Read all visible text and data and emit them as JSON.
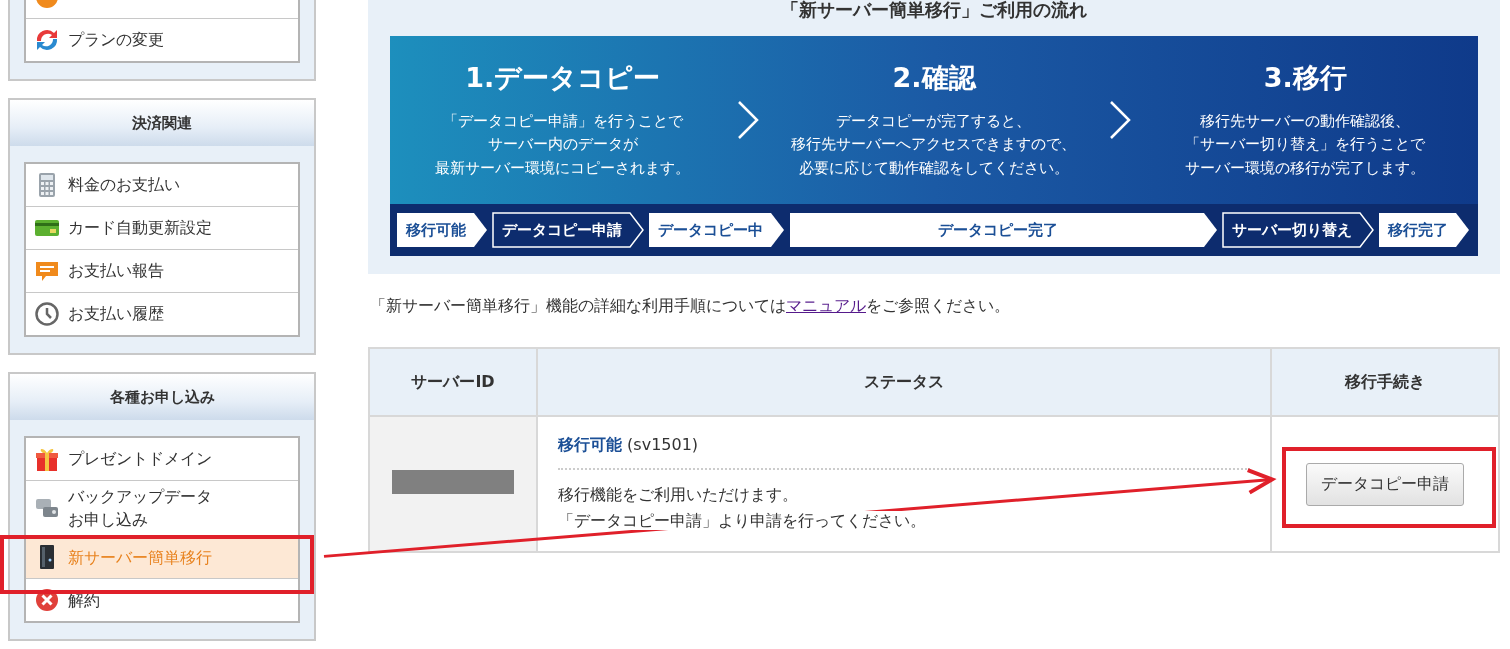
{
  "sidebar": [
    {
      "items": [
        {
          "kind": "circle",
          "selected": false,
          "annotated": false
        },
        {
          "label": "プランの変更",
          "kind": "refresh",
          "selected": false,
          "annotated": false
        }
      ]
    },
    {
      "title": "決済関連",
      "items": [
        {
          "label": "料金のお支払い",
          "kind": "calculator",
          "selected": false,
          "annotated": false
        },
        {
          "label": "カード自動更新設定",
          "kind": "card",
          "selected": false,
          "annotated": false
        },
        {
          "label": "お支払い報告",
          "kind": "speech",
          "selected": false,
          "annotated": false
        },
        {
          "label": "お支払い履歴",
          "kind": "clock",
          "selected": false,
          "annotated": false
        }
      ]
    },
    {
      "title": "各種お申し込み",
      "items": [
        {
          "label": "プレゼントドメイン",
          "kind": "gift",
          "selected": false,
          "annotated": false
        },
        {
          "label": "バックアップデータお申し込み",
          "kind": "drives",
          "selected": false,
          "annotated": false
        },
        {
          "label": "新サーバー簡単移行",
          "kind": "server",
          "selected": true,
          "annotated": true
        },
        {
          "label": "解約",
          "kind": "cancel",
          "selected": false,
          "annotated": false
        }
      ]
    }
  ],
  "flow": {
    "title": "「新サーバー簡単移行」ご利用の流れ",
    "steps": [
      {
        "heading": "1.データコピー",
        "lines": [
          "「データコピー申請」を行うことで",
          "サーバー内のデータが",
          "最新サーバー環境にコピーされます。"
        ]
      },
      {
        "heading": "2.確認",
        "lines": [
          "データコピーが完了すると、",
          "移行先サーバーへアクセスできますので、",
          "必要に応じて動作確認をしてください。"
        ]
      },
      {
        "heading": "3.移行",
        "lines": [
          "移行先サーバーの動作確認後、",
          "「サーバー切り替え」を行うことで",
          "サーバー環境の移行が完了します。"
        ]
      }
    ],
    "stages": [
      {
        "label": "移行可能",
        "kind": "solid",
        "wide": false
      },
      {
        "label": "データコピー申請",
        "kind": "outline",
        "wide": false
      },
      {
        "label": "データコピー中",
        "kind": "solid",
        "wide": false
      },
      {
        "label": "データコピー完了",
        "kind": "solid",
        "wide": true
      },
      {
        "label": "サーバー切り替え",
        "kind": "outline",
        "wide": false
      },
      {
        "label": "移行完了",
        "kind": "solid",
        "wide": false
      }
    ]
  },
  "note": {
    "before": "「新サーバー簡単移行」機能の詳細な利用手順については",
    "link": "マニュアル",
    "after": "をご参照ください。"
  },
  "table": {
    "columns": [
      "サーバーID",
      "ステータス",
      "移行手続き"
    ],
    "rows": [
      {
        "server_id_redacted": true,
        "status_label": "移行可能",
        "server_name": "(sv1501)",
        "description": [
          "移行機能をご利用いただけます。",
          "「データコピー申請」より申請を行ってください。"
        ],
        "action": "データコピー申請",
        "action_annotated": true
      }
    ]
  },
  "annotation_arrow": true
}
